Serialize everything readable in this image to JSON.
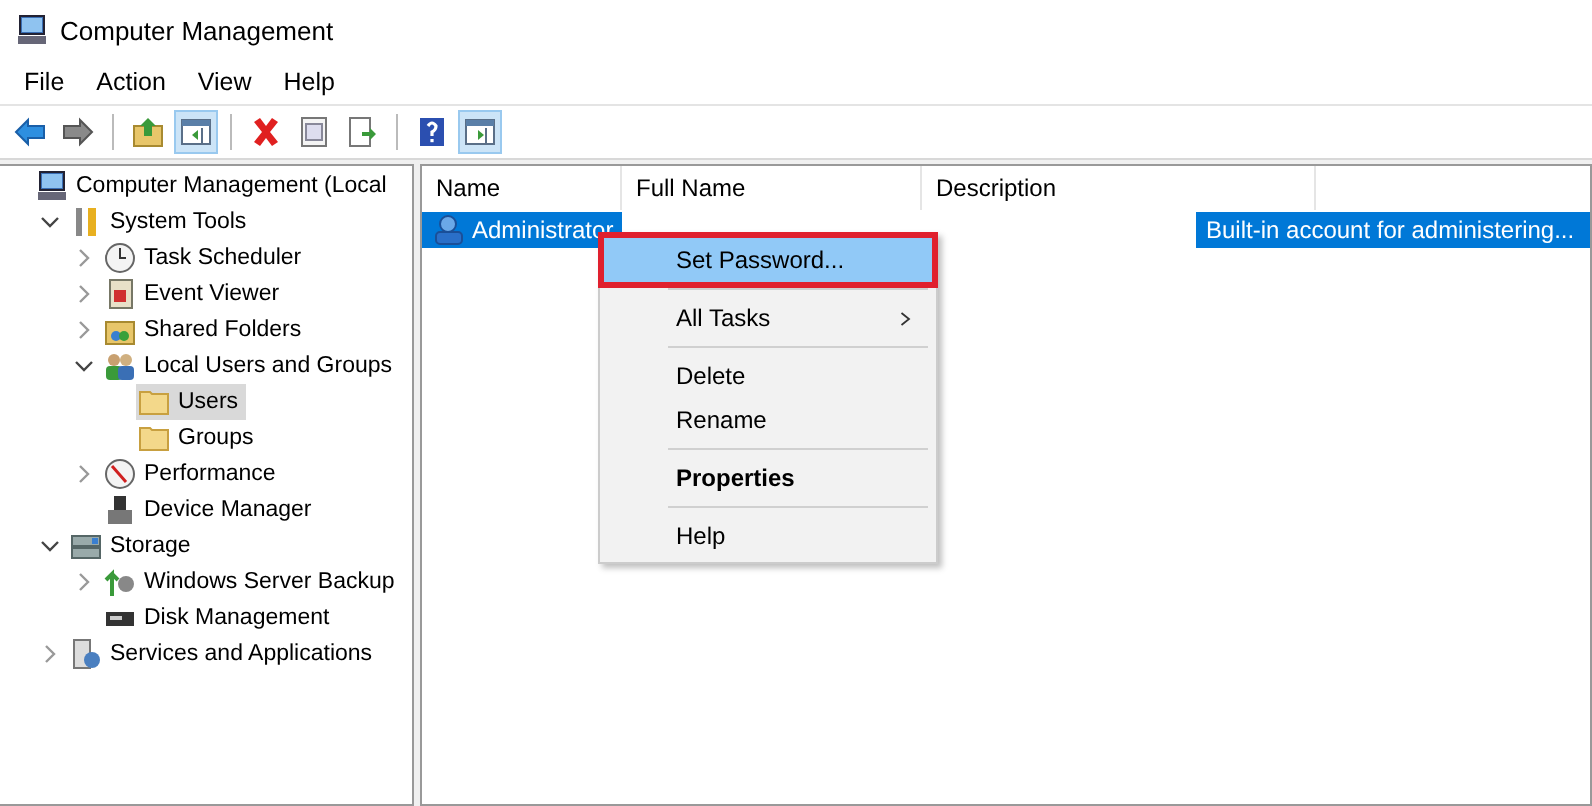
{
  "window": {
    "title": "Computer Management"
  },
  "menu_bar": [
    "File",
    "Action",
    "View",
    "Help"
  ],
  "toolbar": [
    {
      "kind": "back",
      "pressed": false
    },
    {
      "kind": "forward",
      "pressed": false
    },
    {
      "kind": "separator"
    },
    {
      "kind": "up",
      "pressed": false
    },
    {
      "kind": "tree-pane",
      "pressed": true
    },
    {
      "kind": "separator"
    },
    {
      "kind": "delete",
      "pressed": false
    },
    {
      "kind": "properties",
      "pressed": false
    },
    {
      "kind": "export",
      "pressed": false
    },
    {
      "kind": "separator"
    },
    {
      "kind": "help",
      "pressed": false
    },
    {
      "kind": "action-pane",
      "pressed": true
    }
  ],
  "tree": [
    {
      "label": "Computer Management (Local",
      "kind": "computer",
      "selected": false,
      "children": [
        {
          "label": "System Tools",
          "kind": "tools",
          "expanded": true,
          "selected": false,
          "children": [
            {
              "label": "Task Scheduler",
              "kind": "clock",
              "expanded": false,
              "selected": false
            },
            {
              "label": "Event Viewer",
              "kind": "log",
              "expanded": false,
              "selected": false
            },
            {
              "label": "Shared Folders",
              "kind": "share",
              "expanded": false,
              "selected": false
            },
            {
              "label": "Local Users and Groups",
              "kind": "users",
              "expanded": true,
              "selected": false,
              "children": [
                {
                  "label": "Users",
                  "kind": "folder",
                  "selected": true
                },
                {
                  "label": "Groups",
                  "kind": "folder",
                  "selected": false
                }
              ]
            },
            {
              "label": "Performance",
              "kind": "gauge",
              "expanded": false,
              "selected": false
            },
            {
              "label": "Device Manager",
              "kind": "device",
              "selected": false
            }
          ]
        },
        {
          "label": "Storage",
          "kind": "storage",
          "expanded": true,
          "selected": false,
          "children": [
            {
              "label": "Windows Server Backup",
              "kind": "backup",
              "expanded": false,
              "selected": false
            },
            {
              "label": "Disk Management",
              "kind": "disk",
              "selected": false
            }
          ]
        },
        {
          "label": "Services and Applications",
          "kind": "services",
          "expanded": false,
          "selected": false
        }
      ]
    }
  ],
  "table": {
    "columns": [
      "Name",
      "Full Name",
      "Description"
    ],
    "rows": [
      {
        "cells": [
          "Administrator",
          "",
          "Built-in account for administering..."
        ],
        "selected": true
      }
    ]
  },
  "context_menu": [
    {
      "kind": "item",
      "label": "Set Password...",
      "selected": true,
      "highlighted": true,
      "submenu": false,
      "default": false
    },
    {
      "kind": "separator"
    },
    {
      "kind": "item",
      "label": "All Tasks",
      "selected": false,
      "highlighted": false,
      "submenu": true,
      "default": false
    },
    {
      "kind": "separator"
    },
    {
      "kind": "item",
      "label": "Delete",
      "selected": false,
      "highlighted": false,
      "submenu": false,
      "default": false
    },
    {
      "kind": "item",
      "label": "Rename",
      "selected": false,
      "highlighted": false,
      "submenu": false,
      "default": false
    },
    {
      "kind": "separator"
    },
    {
      "kind": "item",
      "label": "Properties",
      "selected": false,
      "highlighted": false,
      "submenu": false,
      "default": true
    },
    {
      "kind": "separator"
    },
    {
      "kind": "item",
      "label": "Help",
      "selected": false,
      "highlighted": false,
      "submenu": false,
      "default": false
    }
  ]
}
